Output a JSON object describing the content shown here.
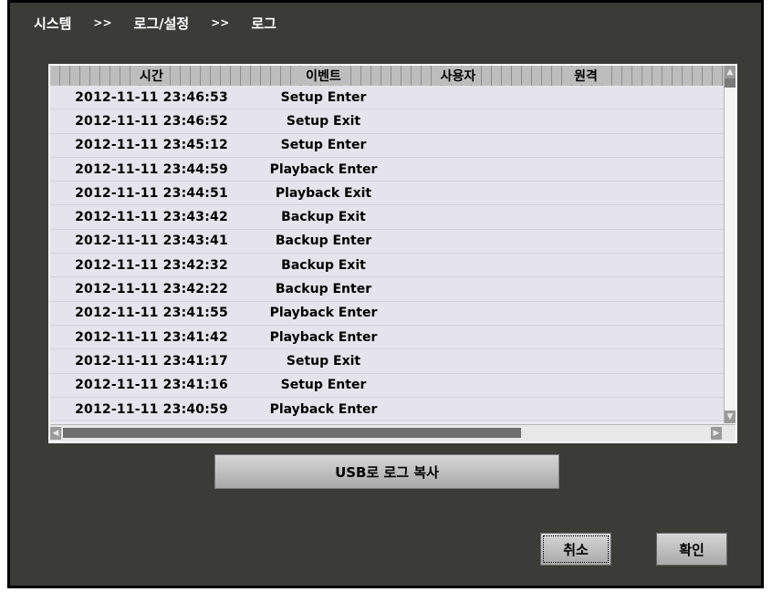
{
  "breadcrumb": {
    "level1": "시스템",
    "sep1": ">>",
    "level2": "로그/설정",
    "sep2": ">>",
    "level3": "로그"
  },
  "table": {
    "columns": {
      "time": "시간",
      "event": "이벤트",
      "user": "사용자",
      "remote": "원격"
    },
    "rows": [
      {
        "time": "2012-11-11  23:46:53",
        "event": "Setup Enter"
      },
      {
        "time": "2012-11-11  23:46:52",
        "event": "Setup Exit"
      },
      {
        "time": "2012-11-11  23:45:12",
        "event": "Setup Enter"
      },
      {
        "time": "2012-11-11  23:44:59",
        "event": "Playback Enter"
      },
      {
        "time": "2012-11-11  23:44:51",
        "event": "Playback Exit"
      },
      {
        "time": "2012-11-11  23:43:42",
        "event": "Backup Exit"
      },
      {
        "time": "2012-11-11  23:43:41",
        "event": "Backup Enter"
      },
      {
        "time": "2012-11-11  23:42:32",
        "event": "Backup Exit"
      },
      {
        "time": "2012-11-11  23:42:22",
        "event": "Backup Enter"
      },
      {
        "time": "2012-11-11  23:41:55",
        "event": "Playback Enter"
      },
      {
        "time": "2012-11-11  23:41:42",
        "event": "Playback Enter"
      },
      {
        "time": "2012-11-11  23:41:17",
        "event": "Setup Exit"
      },
      {
        "time": "2012-11-11  23:41:16",
        "event": "Setup Enter"
      },
      {
        "time": "2012-11-11  23:40:59",
        "event": "Playback Enter"
      }
    ]
  },
  "scroll": {
    "up_icon": "arrow-up-icon",
    "down_icon": "arrow-down-icon",
    "left_icon": "arrow-left-icon",
    "right_icon": "arrow-right-icon"
  },
  "buttons": {
    "usb_copy": "USB로 로그 복사",
    "cancel": "취소",
    "ok": "확인"
  },
  "colors": {
    "background": "#3b3b38",
    "table_row": "#e5e4ec",
    "button": "#c4c4c4"
  }
}
